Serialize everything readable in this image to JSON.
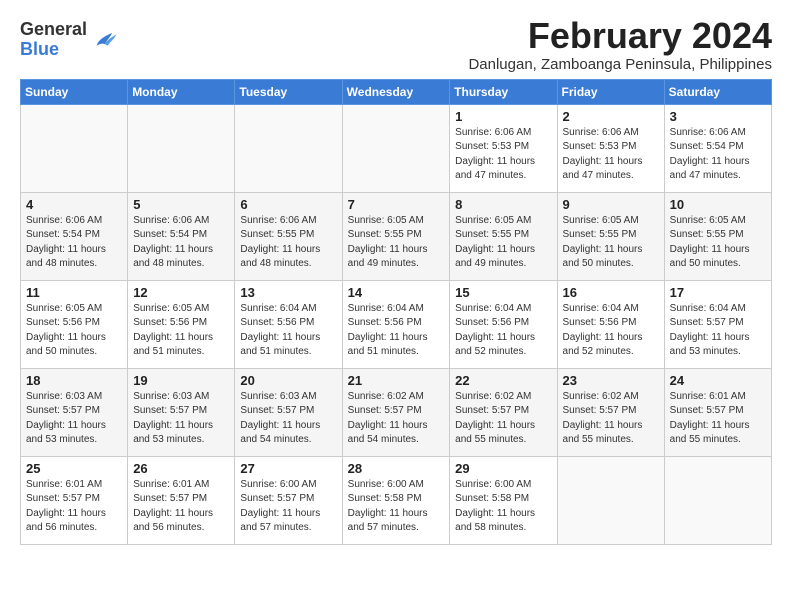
{
  "logo": {
    "general": "General",
    "blue": "Blue"
  },
  "title": {
    "month_year": "February 2024",
    "location": "Danlugan, Zamboanga Peninsula, Philippines"
  },
  "headers": [
    "Sunday",
    "Monday",
    "Tuesday",
    "Wednesday",
    "Thursday",
    "Friday",
    "Saturday"
  ],
  "weeks": [
    [
      {
        "day": "",
        "info": ""
      },
      {
        "day": "",
        "info": ""
      },
      {
        "day": "",
        "info": ""
      },
      {
        "day": "",
        "info": ""
      },
      {
        "day": "1",
        "info": "Sunrise: 6:06 AM\nSunset: 5:53 PM\nDaylight: 11 hours and 47 minutes."
      },
      {
        "day": "2",
        "info": "Sunrise: 6:06 AM\nSunset: 5:53 PM\nDaylight: 11 hours and 47 minutes."
      },
      {
        "day": "3",
        "info": "Sunrise: 6:06 AM\nSunset: 5:54 PM\nDaylight: 11 hours and 47 minutes."
      }
    ],
    [
      {
        "day": "4",
        "info": "Sunrise: 6:06 AM\nSunset: 5:54 PM\nDaylight: 11 hours and 48 minutes."
      },
      {
        "day": "5",
        "info": "Sunrise: 6:06 AM\nSunset: 5:54 PM\nDaylight: 11 hours and 48 minutes."
      },
      {
        "day": "6",
        "info": "Sunrise: 6:06 AM\nSunset: 5:55 PM\nDaylight: 11 hours and 48 minutes."
      },
      {
        "day": "7",
        "info": "Sunrise: 6:05 AM\nSunset: 5:55 PM\nDaylight: 11 hours and 49 minutes."
      },
      {
        "day": "8",
        "info": "Sunrise: 6:05 AM\nSunset: 5:55 PM\nDaylight: 11 hours and 49 minutes."
      },
      {
        "day": "9",
        "info": "Sunrise: 6:05 AM\nSunset: 5:55 PM\nDaylight: 11 hours and 50 minutes."
      },
      {
        "day": "10",
        "info": "Sunrise: 6:05 AM\nSunset: 5:55 PM\nDaylight: 11 hours and 50 minutes."
      }
    ],
    [
      {
        "day": "11",
        "info": "Sunrise: 6:05 AM\nSunset: 5:56 PM\nDaylight: 11 hours and 50 minutes."
      },
      {
        "day": "12",
        "info": "Sunrise: 6:05 AM\nSunset: 5:56 PM\nDaylight: 11 hours and 51 minutes."
      },
      {
        "day": "13",
        "info": "Sunrise: 6:04 AM\nSunset: 5:56 PM\nDaylight: 11 hours and 51 minutes."
      },
      {
        "day": "14",
        "info": "Sunrise: 6:04 AM\nSunset: 5:56 PM\nDaylight: 11 hours and 51 minutes."
      },
      {
        "day": "15",
        "info": "Sunrise: 6:04 AM\nSunset: 5:56 PM\nDaylight: 11 hours and 52 minutes."
      },
      {
        "day": "16",
        "info": "Sunrise: 6:04 AM\nSunset: 5:56 PM\nDaylight: 11 hours and 52 minutes."
      },
      {
        "day": "17",
        "info": "Sunrise: 6:04 AM\nSunset: 5:57 PM\nDaylight: 11 hours and 53 minutes."
      }
    ],
    [
      {
        "day": "18",
        "info": "Sunrise: 6:03 AM\nSunset: 5:57 PM\nDaylight: 11 hours and 53 minutes."
      },
      {
        "day": "19",
        "info": "Sunrise: 6:03 AM\nSunset: 5:57 PM\nDaylight: 11 hours and 53 minutes."
      },
      {
        "day": "20",
        "info": "Sunrise: 6:03 AM\nSunset: 5:57 PM\nDaylight: 11 hours and 54 minutes."
      },
      {
        "day": "21",
        "info": "Sunrise: 6:02 AM\nSunset: 5:57 PM\nDaylight: 11 hours and 54 minutes."
      },
      {
        "day": "22",
        "info": "Sunrise: 6:02 AM\nSunset: 5:57 PM\nDaylight: 11 hours and 55 minutes."
      },
      {
        "day": "23",
        "info": "Sunrise: 6:02 AM\nSunset: 5:57 PM\nDaylight: 11 hours and 55 minutes."
      },
      {
        "day": "24",
        "info": "Sunrise: 6:01 AM\nSunset: 5:57 PM\nDaylight: 11 hours and 55 minutes."
      }
    ],
    [
      {
        "day": "25",
        "info": "Sunrise: 6:01 AM\nSunset: 5:57 PM\nDaylight: 11 hours and 56 minutes."
      },
      {
        "day": "26",
        "info": "Sunrise: 6:01 AM\nSunset: 5:57 PM\nDaylight: 11 hours and 56 minutes."
      },
      {
        "day": "27",
        "info": "Sunrise: 6:00 AM\nSunset: 5:57 PM\nDaylight: 11 hours and 57 minutes."
      },
      {
        "day": "28",
        "info": "Sunrise: 6:00 AM\nSunset: 5:58 PM\nDaylight: 11 hours and 57 minutes."
      },
      {
        "day": "29",
        "info": "Sunrise: 6:00 AM\nSunset: 5:58 PM\nDaylight: 11 hours and 58 minutes."
      },
      {
        "day": "",
        "info": ""
      },
      {
        "day": "",
        "info": ""
      }
    ]
  ]
}
